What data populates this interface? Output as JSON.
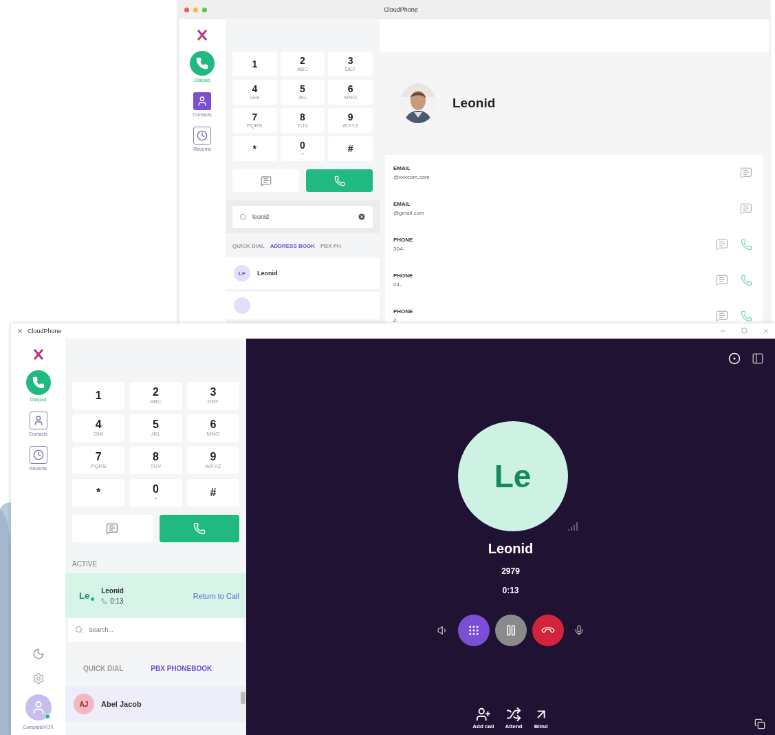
{
  "back_window": {
    "title": "CloudPhone",
    "sidebar": [
      {
        "label": "Dialpad",
        "kind": "dialpad",
        "selected": true,
        "highlighted": false
      },
      {
        "label": "Contacts",
        "kind": "contacts",
        "selected": false,
        "highlighted": true
      },
      {
        "label": "Recents",
        "kind": "recents",
        "selected": false,
        "highlighted": false
      }
    ],
    "keypad": [
      {
        "digit": "1"
      },
      {
        "digit": "2",
        "letters": "ABC"
      },
      {
        "digit": "3",
        "letters": "DEF"
      },
      {
        "digit": "4",
        "letters": "GHI"
      },
      {
        "digit": "5",
        "letters": "JKL"
      },
      {
        "digit": "6",
        "letters": "MNO"
      },
      {
        "digit": "7",
        "letters": "PQRS"
      },
      {
        "digit": "8",
        "letters": "TUV"
      },
      {
        "digit": "9",
        "letters": "WXYZ"
      },
      {
        "digit": "*"
      },
      {
        "digit": "0",
        "letters": "+"
      },
      {
        "digit": "#"
      }
    ],
    "search": {
      "value": "leonid"
    },
    "tabs": [
      {
        "label": "QUICK DIAL",
        "selected": false
      },
      {
        "label": "ADDRESS BOOK",
        "selected": true
      },
      {
        "label": "PBX PH",
        "selected": false
      }
    ],
    "contacts": [
      {
        "kind": "contact",
        "initials": "LF",
        "name": "Leonid"
      },
      {
        "kind": "partial"
      }
    ],
    "detail": {
      "name": "Leonid",
      "fields": [
        {
          "label": "EMAIL",
          "value": "@xxxcom.com",
          "kind": "email"
        },
        {
          "label": "EMAIL",
          "value": "@gmail.com",
          "kind": "email"
        },
        {
          "label": "PHONE",
          "value": "304-",
          "kind": "phone"
        },
        {
          "label": "PHONE",
          "value": "04-",
          "kind": "phone"
        },
        {
          "label": "PHONE",
          "value": "2-",
          "kind": "phone"
        }
      ]
    }
  },
  "front_window": {
    "title": "CloudPhone",
    "sidebar": [
      {
        "label": "Dialpad",
        "kind": "dialpad",
        "selected": true,
        "highlighted": false
      },
      {
        "label": "Contacts",
        "kind": "contacts",
        "selected": false,
        "highlighted": false
      },
      {
        "label": "Recents",
        "kind": "recents",
        "selected": false,
        "highlighted": false
      }
    ],
    "profile": {
      "label": "CompleteVOX",
      "online": true
    },
    "keypad": [
      {
        "digit": "1"
      },
      {
        "digit": "2",
        "letters": "ABC"
      },
      {
        "digit": "3",
        "letters": "DEF"
      },
      {
        "digit": "4",
        "letters": "GHI"
      },
      {
        "digit": "5",
        "letters": "JKL"
      },
      {
        "digit": "6",
        "letters": "MNO"
      },
      {
        "digit": "7",
        "letters": "PQRS"
      },
      {
        "digit": "8",
        "letters": "TUV"
      },
      {
        "digit": "9",
        "letters": "WXYZ"
      },
      {
        "digit": "*"
      },
      {
        "digit": "0",
        "letters": "+"
      },
      {
        "digit": "#"
      }
    ],
    "active": {
      "heading": "ACTIVE",
      "initials": "Le",
      "name": "Leonid",
      "duration": "0:13",
      "action": "Return to Call"
    },
    "search": {
      "placeholder": "Search..."
    },
    "tabs": [
      {
        "label": "QUICK DIAL",
        "selected": false
      },
      {
        "label": "PBX PHONEBOOK",
        "selected": true
      }
    ],
    "contacts": [
      {
        "initials": "AJ",
        "name": "Abel Jacob"
      }
    ],
    "call": {
      "initials": "Le",
      "name": "Leonid",
      "number": "2979",
      "duration": "0:13",
      "controls": [
        {
          "kind": "speaker"
        },
        {
          "kind": "dialpad"
        },
        {
          "kind": "hold"
        },
        {
          "kind": "hangup"
        },
        {
          "kind": "mic"
        }
      ],
      "transfers": [
        {
          "kind": "add",
          "label": "Add call"
        },
        {
          "kind": "attended",
          "label": "Attend"
        },
        {
          "kind": "blind",
          "label": "Blind"
        }
      ]
    }
  }
}
